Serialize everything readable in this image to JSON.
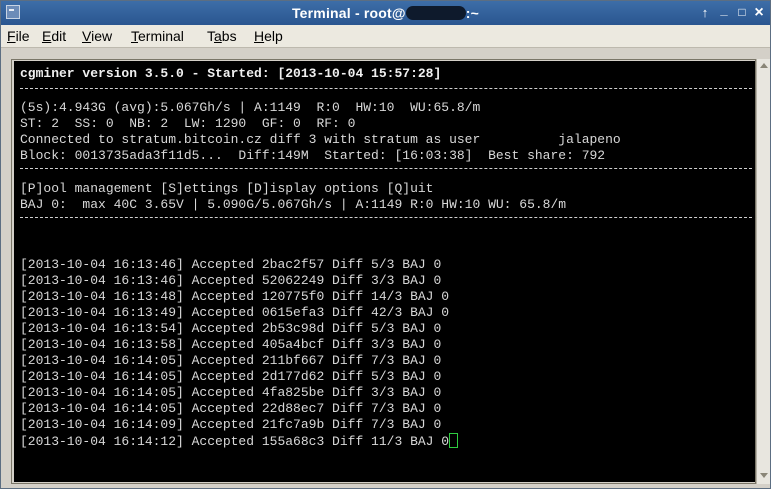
{
  "window": {
    "title_prefix": "Terminal - root@",
    "title_suffix": ":~",
    "controls": {
      "up": "↑",
      "minimize": "_",
      "maximize": "□",
      "close": "×"
    }
  },
  "menu": [
    "File",
    "Edit",
    "View",
    "Terminal",
    "Tabs",
    "Help"
  ],
  "menu_mnemonic": [
    "F",
    "E",
    "V",
    "T",
    "a",
    "H"
  ],
  "terminal": {
    "header": "cgminer version 3.5.0 - Started: [2013-10-04 15:57:28]",
    "status": [
      "(5s):4.943G (avg):5.067Gh/s | A:1149  R:0  HW:10  WU:65.8/m",
      "ST: 2  SS: 0  NB: 2  LW: 1290  GF: 0  RF: 0",
      "Connected to stratum.bitcoin.cz diff 3 with stratum as user          jalapeno",
      "Block: 0013735ada3f11d5...  Diff:149M  Started: [16:03:38]  Best share: 792"
    ],
    "options": [
      "[P]ool management [S]ettings [D]isplay options [Q]uit",
      "BAJ 0:  max 40C 3.65V | 5.090G/5.067Gh/s | A:1149 R:0 HW:10 WU: 65.8/m"
    ],
    "log": [
      "[2013-10-04 16:13:46] Accepted 2bac2f57 Diff 5/3 BAJ 0",
      "[2013-10-04 16:13:46] Accepted 52062249 Diff 3/3 BAJ 0",
      "[2013-10-04 16:13:48] Accepted 120775f0 Diff 14/3 BAJ 0",
      "[2013-10-04 16:13:49] Accepted 0615efa3 Diff 42/3 BAJ 0",
      "[2013-10-04 16:13:54] Accepted 2b53c98d Diff 5/3 BAJ 0",
      "[2013-10-04 16:13:58] Accepted 405a4bcf Diff 3/3 BAJ 0",
      "[2013-10-04 16:14:05] Accepted 211bf667 Diff 7/3 BAJ 0",
      "[2013-10-04 16:14:05] Accepted 2d177d62 Diff 5/3 BAJ 0",
      "[2013-10-04 16:14:05] Accepted 4fa825be Diff 3/3 BAJ 0",
      "[2013-10-04 16:14:05] Accepted 22d88ec7 Diff 7/3 BAJ 0",
      "[2013-10-04 16:14:09] Accepted 21fc7a9b Diff 7/3 BAJ 0",
      "[2013-10-04 16:14:12] Accepted 155a68c3 Diff 11/3 BAJ 0"
    ]
  },
  "colors": {
    "titlebar": "#2f5f9c",
    "terminal_bg": "#000000",
    "terminal_fg": "#d8d8d8",
    "cursor": "#2ecc40"
  }
}
